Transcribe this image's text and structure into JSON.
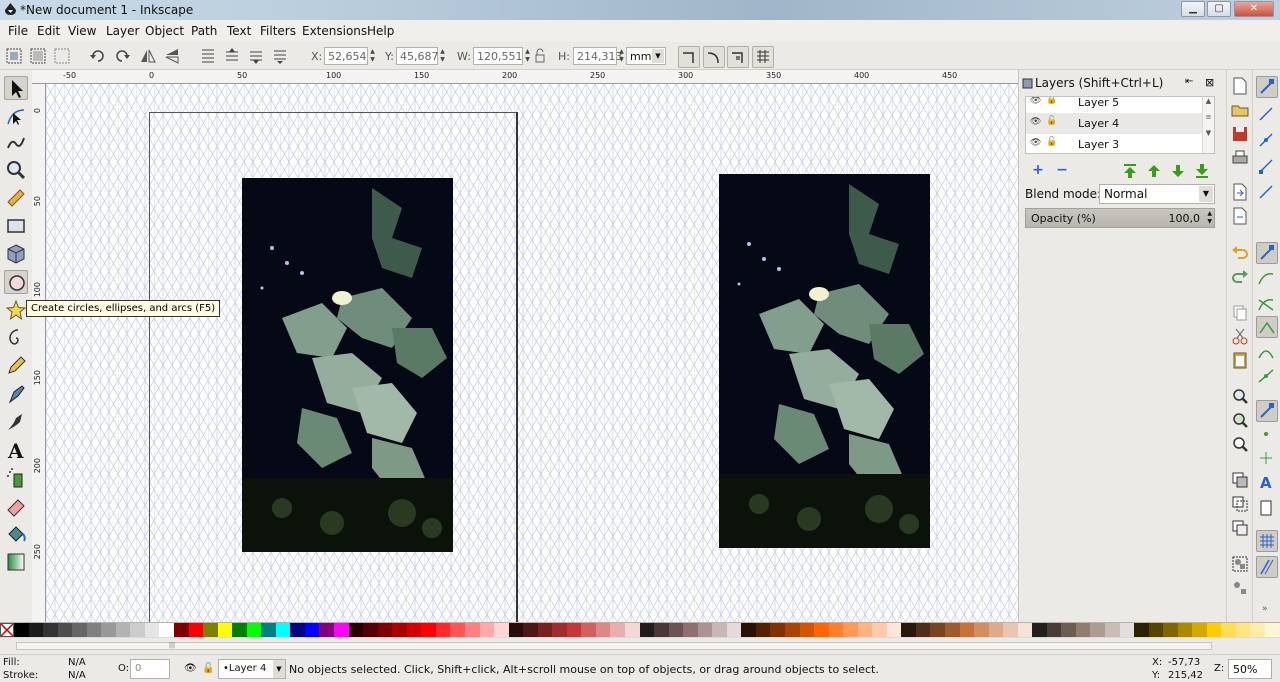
{
  "window": {
    "title": "*New document 1 - Inkscape",
    "minimize_glyph": "▁",
    "maximize_glyph": "▢",
    "close_glyph": "✕"
  },
  "menu": [
    "File",
    "Edit",
    "View",
    "Layer",
    "Object",
    "Path",
    "Text",
    "Filters",
    "Extensions",
    "Help"
  ],
  "tool_controls": {
    "x_label": "X:",
    "x_value": "52,654",
    "y_label": "Y:",
    "y_value": "45,687",
    "w_label": "W:",
    "w_value": "120,551",
    "h_label": "H:",
    "h_value": "214,313",
    "unit": "mm"
  },
  "ruler": {
    "h_ticks": [
      "-50",
      "0",
      "50",
      "100",
      "150",
      "200",
      "250",
      "300",
      "350",
      "400",
      "450"
    ],
    "v_ticks": [
      "0",
      "50",
      "100",
      "150",
      "200",
      "250"
    ]
  },
  "tooltip": "Create circles, ellipses, and arcs (F5)",
  "layers_panel": {
    "title": "Layers (Shift+Ctrl+L)",
    "layers": [
      {
        "name": "Layer 5",
        "selected": false
      },
      {
        "name": "Layer 4",
        "selected": true
      },
      {
        "name": "Layer 3",
        "selected": false
      }
    ],
    "add_glyph": "+",
    "remove_glyph": "−",
    "blend_label": "Blend mode:",
    "blend_value": "Normal",
    "opacity_label": "Opacity (%)",
    "opacity_value": "100,0"
  },
  "status": {
    "fill_label": "Fill:",
    "fill_value": "N/A",
    "stroke_label": "Stroke:",
    "stroke_value": "N/A",
    "o_label": "O:",
    "o_value": "0",
    "layer_select": "•Layer 4",
    "message": "No objects selected. Click, Shift+click, Alt+scroll mouse on top of objects, or drag around objects to select.",
    "x_label": "X:",
    "x_value": "-57,73",
    "y_label": "Y:",
    "y_value": "215,42",
    "z_label": "Z:",
    "zoom": "50%"
  },
  "palette_colors": [
    "#000000",
    "#1a1a1a",
    "#333333",
    "#4d4d4d",
    "#666666",
    "#808080",
    "#999999",
    "#b3b3b3",
    "#cccccc",
    "#e6e6e6",
    "#ffffff",
    "#800000",
    "#ff0000",
    "#808000",
    "#ffff00",
    "#008000",
    "#00ff00",
    "#008080",
    "#00ffff",
    "#000080",
    "#0000ff",
    "#800080",
    "#ff00ff",
    "#2b0000",
    "#550000",
    "#800000",
    "#aa0000",
    "#d40000",
    "#ff0000",
    "#ff2a2a",
    "#ff5555",
    "#ff8080",
    "#ffaaaa",
    "#ffd5d5",
    "#280b0b",
    "#501616",
    "#782121",
    "#a02c2c",
    "#c83737",
    "#d35f5f",
    "#de8787",
    "#e9afaf",
    "#f4d7d7",
    "#241c1c",
    "#483737",
    "#6c5353",
    "#916f6f",
    "#ac9393",
    "#c8b7b7",
    "#e3dbdb",
    "#2b1100",
    "#552200",
    "#803300",
    "#aa4400",
    "#d45500",
    "#ff6600",
    "#ff7f2a",
    "#ff9955",
    "#ffb380",
    "#ffccaa",
    "#ffe6d5",
    "#28170b",
    "#502d16",
    "#784421",
    "#a05a2c",
    "#c87137",
    "#d38d5f",
    "#deaa87",
    "#e9c6af",
    "#f4e3d7",
    "#241f1c",
    "#483e37",
    "#6c5d53",
    "#917c6f",
    "#ac9d93",
    "#c8beb7",
    "#e3dedb",
    "#2b2200",
    "#554400",
    "#806600",
    "#aa8800",
    "#d4aa00",
    "#ffcc00",
    "#ffdd55",
    "#ffe680",
    "#ffeeaa",
    "#fff6d5"
  ]
}
